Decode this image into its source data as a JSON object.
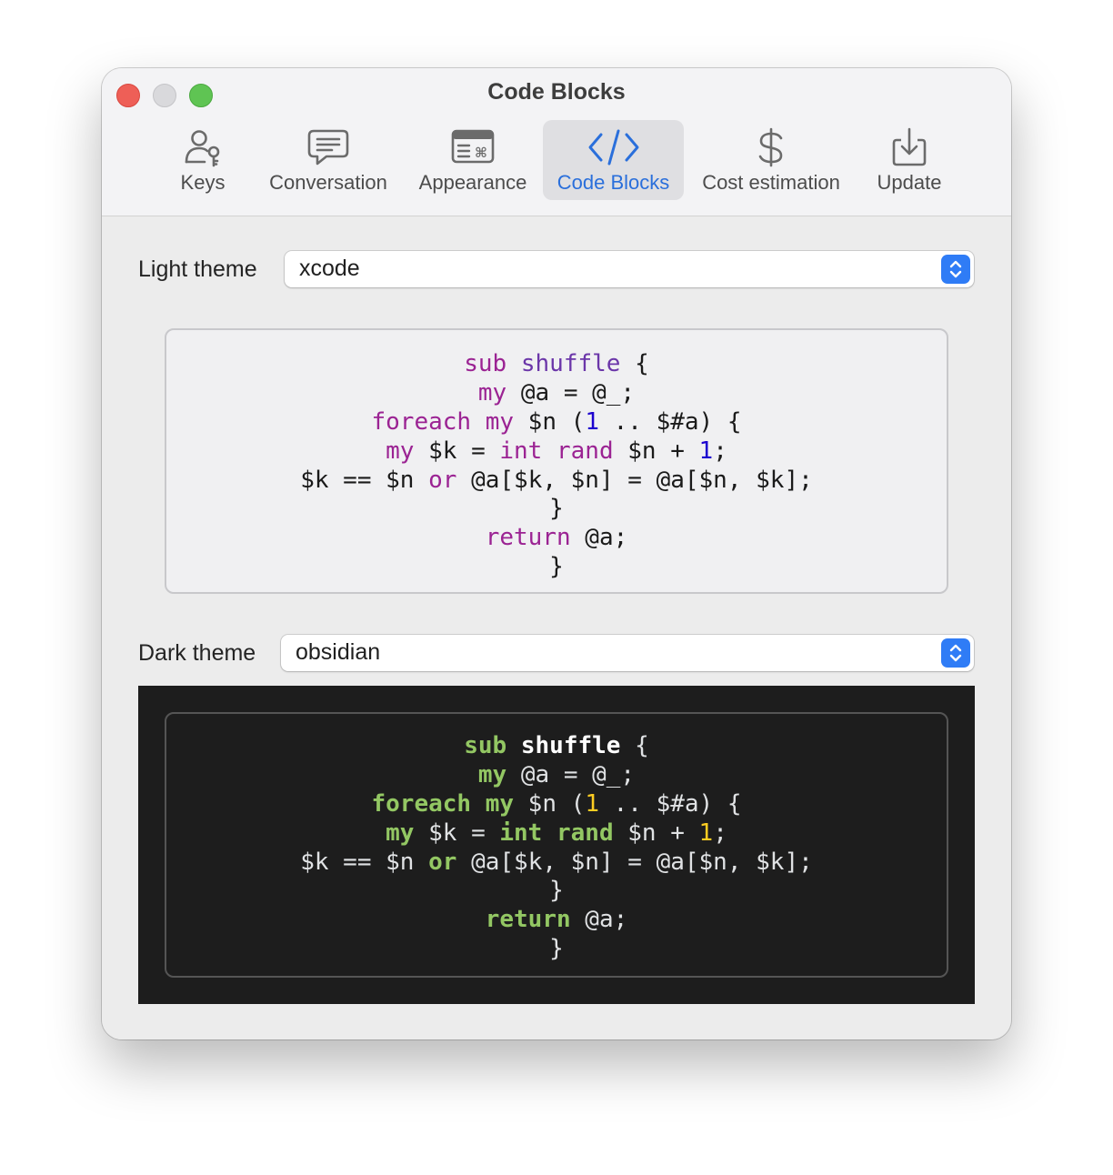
{
  "window": {
    "title": "Code Blocks"
  },
  "toolbar": {
    "items": [
      {
        "label": "Keys",
        "icon": "person-key-icon"
      },
      {
        "label": "Conversation",
        "icon": "speech-bubble-icon"
      },
      {
        "label": "Appearance",
        "icon": "window-command-icon"
      },
      {
        "label": "Code Blocks",
        "icon": "code-brackets-icon",
        "active": true
      },
      {
        "label": "Cost estimation",
        "icon": "dollar-icon"
      },
      {
        "label": "Update",
        "icon": "download-tray-icon"
      }
    ],
    "active_color": "#2a6fdb"
  },
  "light": {
    "label": "Light theme",
    "value": "xcode"
  },
  "dark": {
    "label": "Dark theme",
    "value": "obsidian"
  },
  "code": {
    "l1": {
      "a": "sub",
      "b": " ",
      "c": "shuffle",
      "d": " {"
    },
    "l2": {
      "a": "my",
      "b": " @a = @_;"
    },
    "l3": {
      "a": "foreach",
      "b": " ",
      "c": "my",
      "d": " $n (",
      "e": "1",
      "f": " .. $#a) {"
    },
    "l4": {
      "a": "my",
      "b": " $k = ",
      "c": "int",
      "d": " ",
      "e": "rand",
      "f": " $n + ",
      "g": "1",
      "h": ";"
    },
    "l5": {
      "a": "$k == $n ",
      "b": "or",
      "c": " @a[$k, $n] = @a[$n, $k];"
    },
    "l6": {
      "a": "}"
    },
    "l7": {
      "a": "return",
      "b": " @a;"
    },
    "l8": {
      "a": "}"
    }
  },
  "colors": {
    "light_keyword": "#9b2393",
    "light_number": "#1c00cf",
    "dark_keyword": "#93c763",
    "dark_number": "#ffcd22",
    "dark_background": "#1d1d1d",
    "accent": "#2f7cf6"
  }
}
